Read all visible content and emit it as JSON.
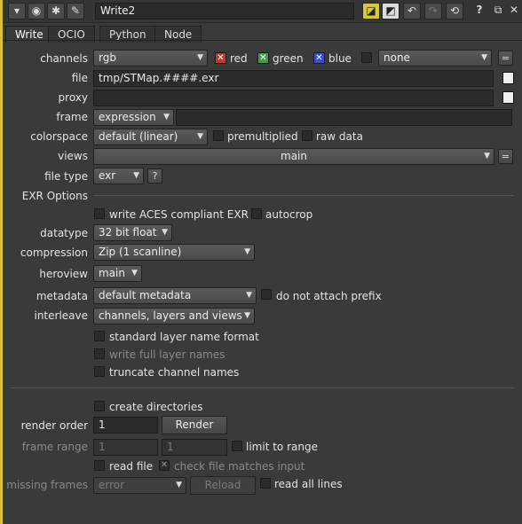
{
  "node_name": "Write2",
  "toolbar": {
    "help_label": "?"
  },
  "tabs": [
    "Write",
    "OCIO",
    "Python",
    "Node"
  ],
  "channels": {
    "label": "channels",
    "value": "rgb",
    "red": "red",
    "green": "green",
    "blue": "blue",
    "alpha_value": "none"
  },
  "file": {
    "label": "file",
    "value": "tmp/STMap.####.exr"
  },
  "proxy": {
    "label": "proxy",
    "value": ""
  },
  "frame": {
    "label": "frame",
    "mode": "expression",
    "value": ""
  },
  "colorspace": {
    "label": "colorspace",
    "value": "default (linear)",
    "premultiplied": "premultiplied",
    "raw_data": "raw data"
  },
  "views": {
    "label": "views",
    "value": "main"
  },
  "file_type": {
    "label": "file type",
    "value": "exr",
    "help": "?"
  },
  "exr_options": {
    "section": "EXR Options",
    "aces": "write ACES compliant EXR",
    "autocrop": "autocrop",
    "datatype_label": "datatype",
    "datatype": "32 bit float",
    "compression_label": "compression",
    "compression": "Zip (1 scanline)",
    "heroview_label": "heroview",
    "heroview": "main",
    "metadata_label": "metadata",
    "metadata": "default metadata",
    "no_prefix": "do not attach prefix",
    "interleave_label": "interleave",
    "interleave": "channels, layers and views",
    "standard_layer": "standard layer name format",
    "write_full_layer": "write full layer names",
    "truncate": "truncate channel names"
  },
  "render": {
    "create_dirs": "create directories",
    "render_order_label": "render order",
    "render_order": "1",
    "render_button": "Render",
    "frame_range_label": "frame range",
    "frame_start": "1",
    "frame_end": "1",
    "limit_to_range": "limit to range",
    "read_file": "read file",
    "check_file": "check file matches input",
    "missing_frames_label": "missing frames",
    "missing_frames": "error",
    "reload_button": "Reload",
    "read_all_lines": "read all lines"
  },
  "colors": {
    "panel_border": "#d9c23a",
    "red_check": "#c0392b",
    "green_check": "#3f9e48",
    "blue_check": "#3a4fc4"
  }
}
